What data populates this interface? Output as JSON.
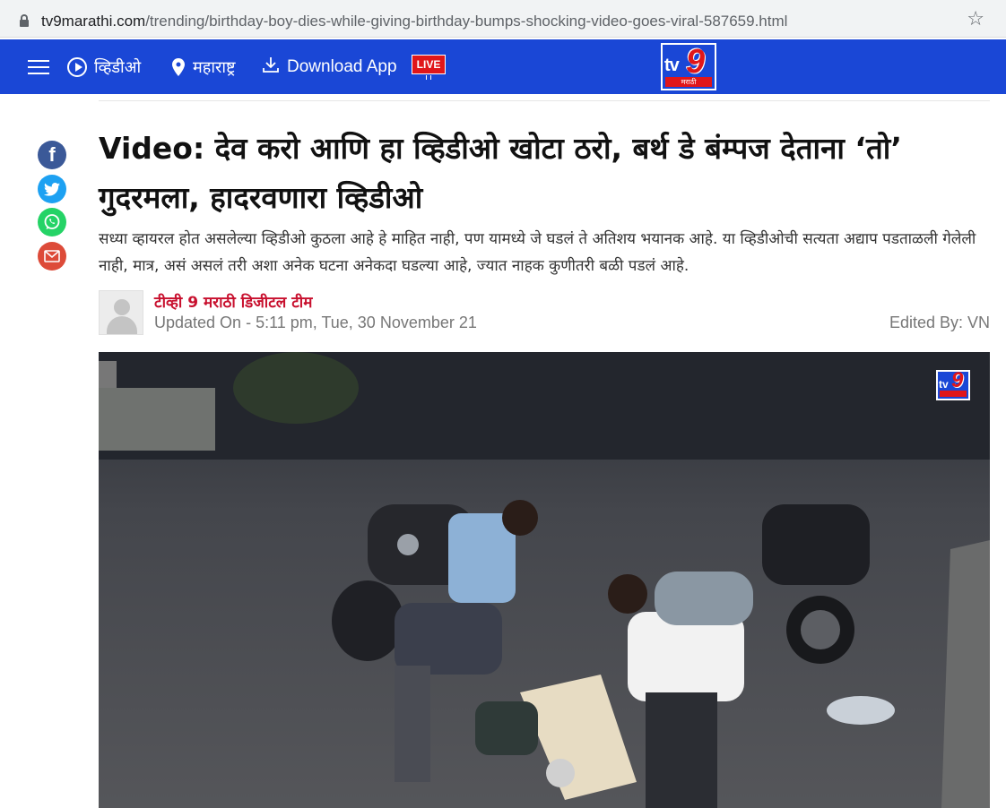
{
  "browser": {
    "url_domain": "tv9marathi.com",
    "url_path": "/trending/birthday-boy-dies-while-giving-birthday-bumps-shocking-video-goes-viral-587659.html"
  },
  "nav": {
    "video_label": "व्हिडीओ",
    "state_label": "महाराष्ट्र",
    "download_label": "Download App",
    "live_label": "LIVE",
    "logo_text": "tv",
    "logo_number": "9",
    "logo_sub": "मराठी"
  },
  "article": {
    "headline": "Video: देव करो आणि हा व्हिडीओ खोटा ठरो, बर्थ डे बंम्पज देताना ‘तो’ गुदरमला, हादरवणारा व्हिडीओ",
    "summary": "सध्या व्हायरल होत असलेल्या व्हिडीओ कुठला आहे हे माहित नाही, पण यामध्ये जे घडलं ते अतिशय भयानक आहे. या व्हिडीओची सत्यता अद्याप पडताळली गेलेली नाही, मात्र, असं असलं तरी अशा अनेक घटना अनेकदा घडल्या आहे, ज्यात नाहक कुणीतरी बळी पडलं आहे.",
    "author": "टीव्ही 9 मराठी डिजीटल टीम",
    "updated": "Updated On - 5:11 pm, Tue, 30 November 21",
    "edited_by": "Edited By: VN"
  },
  "share": {
    "facebook_icon": "f"
  },
  "video": {
    "watermark_text": "tv",
    "watermark_number": "9"
  },
  "colors": {
    "nav_blue": "#1a47d6",
    "brand_red": "#e0161a",
    "author_red": "#c8102e"
  }
}
